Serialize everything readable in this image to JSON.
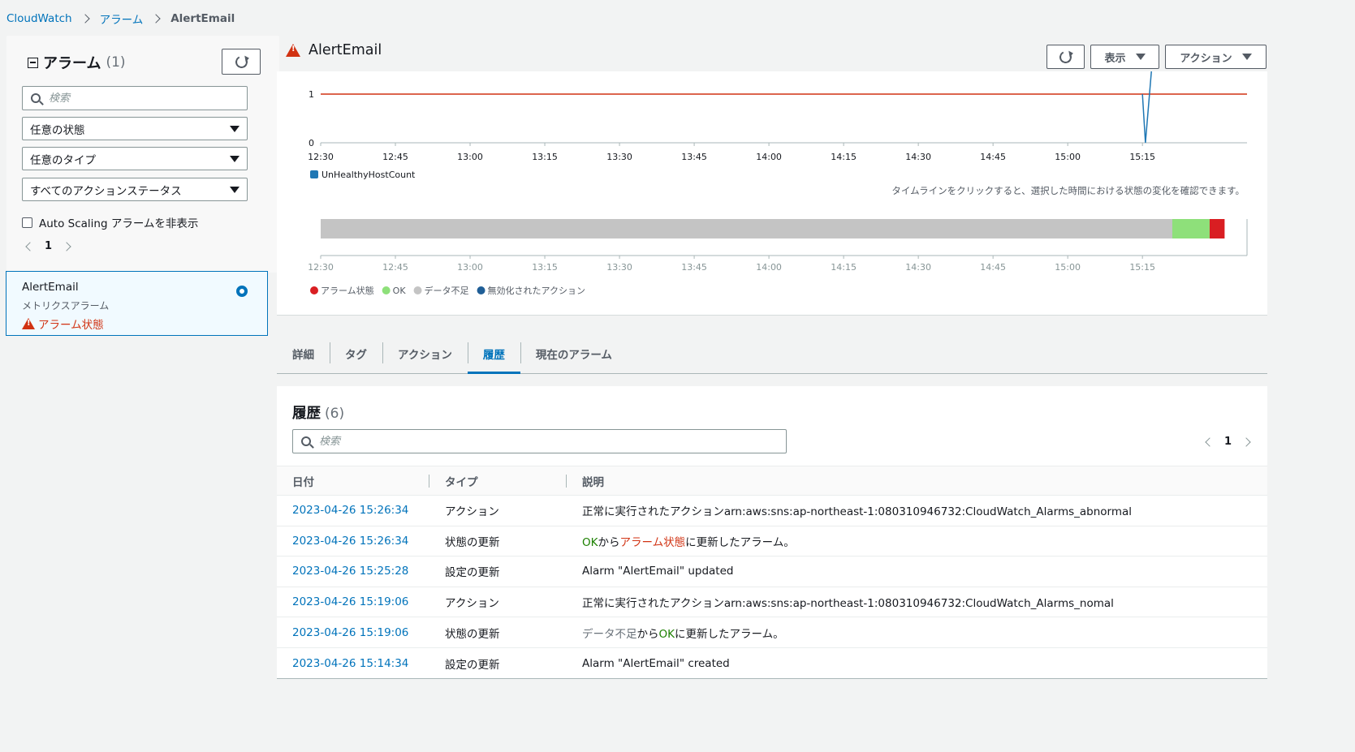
{
  "breadcrumb": {
    "root": "CloudWatch",
    "alarms": "アラーム",
    "current": "AlertEmail"
  },
  "left_panel": {
    "title": "アラーム",
    "count": "(1)",
    "search_placeholder": "検索",
    "filters": {
      "state": "任意の状態",
      "type": "任意のタイプ",
      "action_status": "すべてのアクションステータス"
    },
    "hide_autoscaling_label": "Auto Scaling アラームを非表示",
    "page": "1",
    "alarm_item": {
      "name": "AlertEmail",
      "type": "メトリクスアラーム",
      "state": "アラーム状態"
    }
  },
  "header": {
    "title": "AlertEmail",
    "view_button": "表示",
    "actions_button": "アクション"
  },
  "chart_data": {
    "type": "line",
    "x": [
      "12:30",
      "12:45",
      "13:00",
      "13:15",
      "13:30",
      "13:45",
      "14:00",
      "14:15",
      "14:30",
      "14:45",
      "15:00",
      "15:15"
    ],
    "yticks": [
      "0",
      "1"
    ],
    "ylim": [
      0,
      1
    ],
    "threshold": 1,
    "series": [
      {
        "name": "UnHealthyHostCount",
        "color": "#1f77b4",
        "points": [
          [
            15.25,
            1
          ],
          [
            15.26,
            0
          ],
          [
            15.28,
            1.9
          ]
        ]
      }
    ],
    "threshold_color": "#d13212",
    "legend": "bottom-left"
  },
  "timeline": {
    "hint": "タイムラインをクリックすると、選択した時間における状態の変化を確認できます。",
    "segments": [
      {
        "state": "insufficient",
        "from": 12.5,
        "to": 15.35,
        "color": "#c4c4c4"
      },
      {
        "state": "ok",
        "from": 15.35,
        "to": 15.475,
        "color": "#8ee07a"
      },
      {
        "state": "alarm",
        "from": 15.475,
        "to": 15.525,
        "color": "#d91e22"
      }
    ],
    "legend": [
      {
        "label": "アラーム状態",
        "color": "#d91e22"
      },
      {
        "label": "OK",
        "color": "#8ee07a"
      },
      {
        "label": "データ不足",
        "color": "#c4c4c4"
      },
      {
        "label": "無効化されたアクション",
        "color": "#1f5e96"
      }
    ]
  },
  "tabs": [
    "詳細",
    "タグ",
    "アクション",
    "履歴",
    "現在のアラーム"
  ],
  "active_tab": 3,
  "history": {
    "title": "履歴",
    "count": "(6)",
    "search_placeholder": "検索",
    "page": "1",
    "columns": [
      "日付",
      "タイプ",
      "説明"
    ],
    "rows": [
      {
        "date": "2023-04-26 15:26:34",
        "type": "アクション",
        "desc": "正常に実行されたアクションarn:aws:sns:ap-northeast-1:080310946732:CloudWatch_Alarms_abnormal"
      },
      {
        "date": "2023-04-26 15:26:34",
        "type": "状態の更新",
        "desc_parts": [
          "OK",
          "から",
          "アラーム状態",
          "に更新したアラーム。"
        ]
      },
      {
        "date": "2023-04-26 15:25:28",
        "type": "設定の更新",
        "desc": "Alarm \"AlertEmail\" updated"
      },
      {
        "date": "2023-04-26 15:19:06",
        "type": "アクション",
        "desc": "正常に実行されたアクションarn:aws:sns:ap-northeast-1:080310946732:CloudWatch_Alarms_nomal"
      },
      {
        "date": "2023-04-26 15:19:06",
        "type": "状態の更新",
        "desc_parts": [
          "データ不足",
          "から",
          "OK",
          "に更新したアラーム。"
        ]
      },
      {
        "date": "2023-04-26 15:14:34",
        "type": "設定の更新",
        "desc": "Alarm \"AlertEmail\" created"
      }
    ]
  }
}
